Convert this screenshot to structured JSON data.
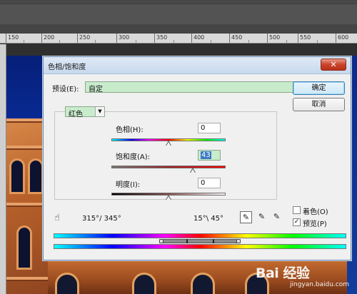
{
  "workspace": {
    "ruler_ticks": [
      "150",
      "200",
      "250",
      "300",
      "350",
      "400",
      "450",
      "500",
      "550",
      "600"
    ]
  },
  "dialog": {
    "title": "色相/饱和度",
    "close_symbol": "✕",
    "preset_label": "预设(E):",
    "preset_value": "自定",
    "ok_label": "确定",
    "cancel_label": "取消",
    "channel_value": "红色",
    "hue": {
      "label": "色相(H):",
      "value": "0",
      "position": 0.5
    },
    "saturation": {
      "label": "饱和度(A):",
      "value": "43",
      "position": 0.71
    },
    "lightness": {
      "label": "明度(I):",
      "value": "0",
      "position": 0.5
    },
    "range_left": "315°/ 345°",
    "range_right": "15°\\ 45°",
    "colorize": {
      "label": "着色(O)",
      "checked": false
    },
    "preview": {
      "label": "预览(P)",
      "checked": true,
      "check_mark": "✓"
    },
    "tools": [
      "eyedropper-icon",
      "eyedropper-plus-icon",
      "eyedropper-minus-icon"
    ]
  },
  "watermark": {
    "brand": "Bai 经验",
    "url": "jingyan.baidu.com"
  },
  "colors": {
    "field_green": "#c8ebcc",
    "title_blue": "#c8d9ee",
    "close_red": "#c9432b",
    "selection_blue": "#3b79c4"
  }
}
